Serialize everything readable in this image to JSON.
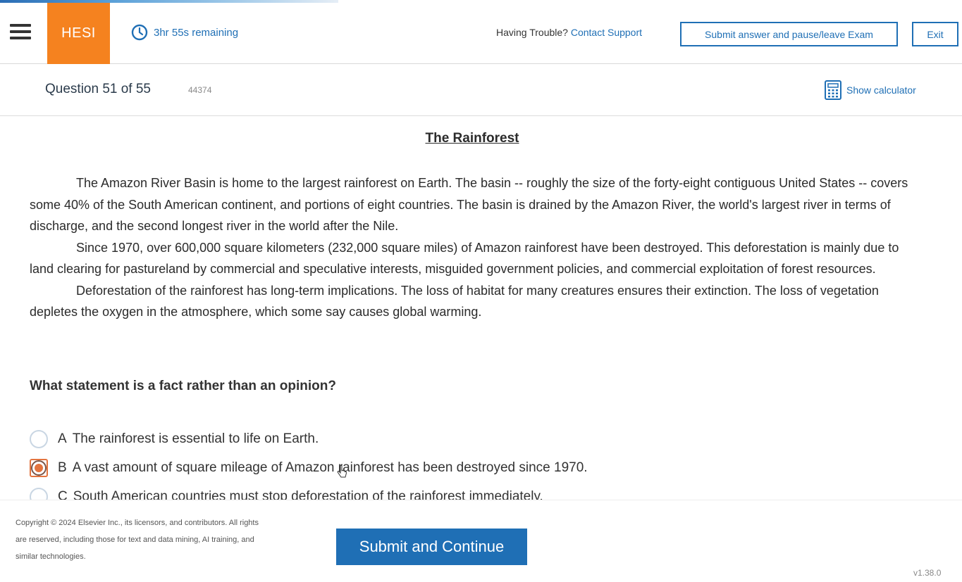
{
  "header": {
    "logo": "HESI",
    "timer": "3hr 55s remaining",
    "help_text": "Having Trouble?",
    "help_link": "Contact Support",
    "pause_button": "Submit answer and pause/leave Exam",
    "exit_button": "Exit"
  },
  "subheader": {
    "question_count": "Question 51 of 55",
    "question_id": "44374",
    "calculator": "Show calculator"
  },
  "passage": {
    "title": "The Rainforest",
    "paragraphs": [
      "The Amazon River Basin is home to the largest rainforest on Earth. The basin -- roughly the size of the forty-eight contiguous United States -- covers some 40% of the South American continent, and portions of eight countries.  The basin is drained by the Amazon River, the world's largest river in terms of discharge, and the second longest river in the world after the Nile.",
      "Since 1970, over 600,000 square kilometers (232,000 square miles) of Amazon rainforest have been destroyed.  This deforestation is mainly due to land clearing for pastureland by commercial and speculative interests, misguided government policies, and commercial exploitation of forest resources.",
      "Deforestation of the rainforest has long-term implications.  The loss of habitat for many creatures ensures their extinction.  The loss of vegetation depletes the oxygen in the atmosphere, which some say causes global warming."
    ]
  },
  "question": "What statement is a fact rather than an opinion?",
  "options": [
    {
      "letter": "A",
      "text": "The rainforest is essential to life on Earth."
    },
    {
      "letter": "B",
      "text": "A vast amount of square mileage of Amazon rainforest has been destroyed since 1970."
    },
    {
      "letter": "C",
      "text": "South American countries must stop deforestation of the rainforest immediately."
    }
  ],
  "selected_option": "B",
  "footer": {
    "copyright": "Copyright © 2024 Elsevier Inc., its licensors, and contributors. All rights are reserved, including those for text and data mining, AI training, and similar technologies.",
    "submit_button": "Submit and Continue",
    "version": "v1.38.0"
  },
  "colors": {
    "accent": "#1f6fb5",
    "logo_bg": "#f5821f",
    "selected": "#e3743f"
  }
}
